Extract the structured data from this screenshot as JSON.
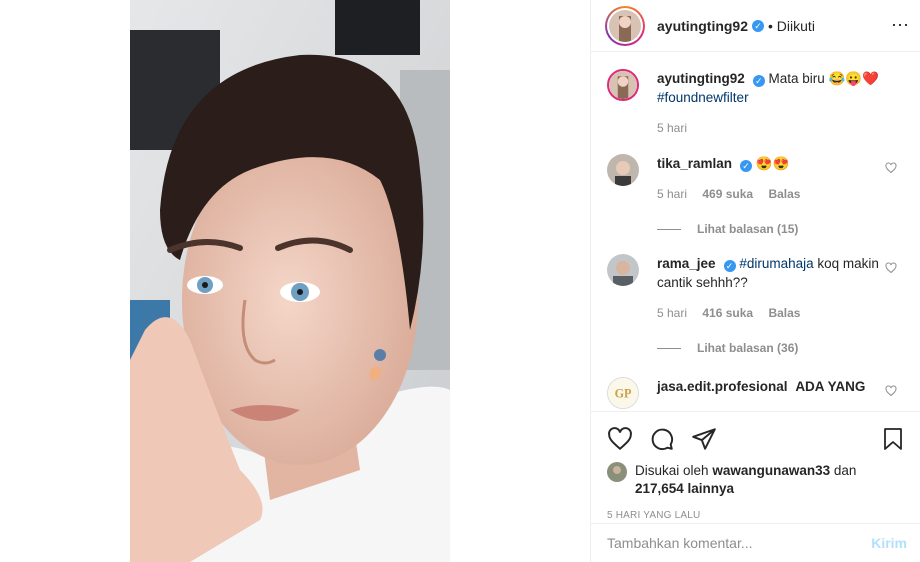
{
  "post": {
    "author": "ayutingting92",
    "follow_state": "• Diikuti",
    "caption_text": "Mata biru 😂😛❤️",
    "caption_hashtag": "#foundnewfilter",
    "caption_age": "5 hari"
  },
  "comments": [
    {
      "user": "tika_ramlan",
      "verified": true,
      "text": "😍😍",
      "age": "5 hari",
      "likes": "469 suka",
      "reply_label": "Balas",
      "view_replies": "Lihat balasan (15)"
    },
    {
      "user": "rama_jee",
      "verified": true,
      "hashtag": "#dirumahaja",
      "text": " koq makin cantik sehhh??",
      "age": "5 hari",
      "likes": "416 suka",
      "reply_label": "Balas",
      "view_replies": "Lihat balasan (36)"
    },
    {
      "user": "jasa.edit.profesional",
      "text": "ADA YANG"
    }
  ],
  "likes": {
    "prefix": "Disukai oleh",
    "user": "wawangunawan33",
    "and": "dan",
    "count": "217,654 lainnya"
  },
  "timestamp": "5 HARI YANG LALU",
  "comment_input": {
    "placeholder": "Tambahkan komentar...",
    "post_label": "Kirim"
  }
}
